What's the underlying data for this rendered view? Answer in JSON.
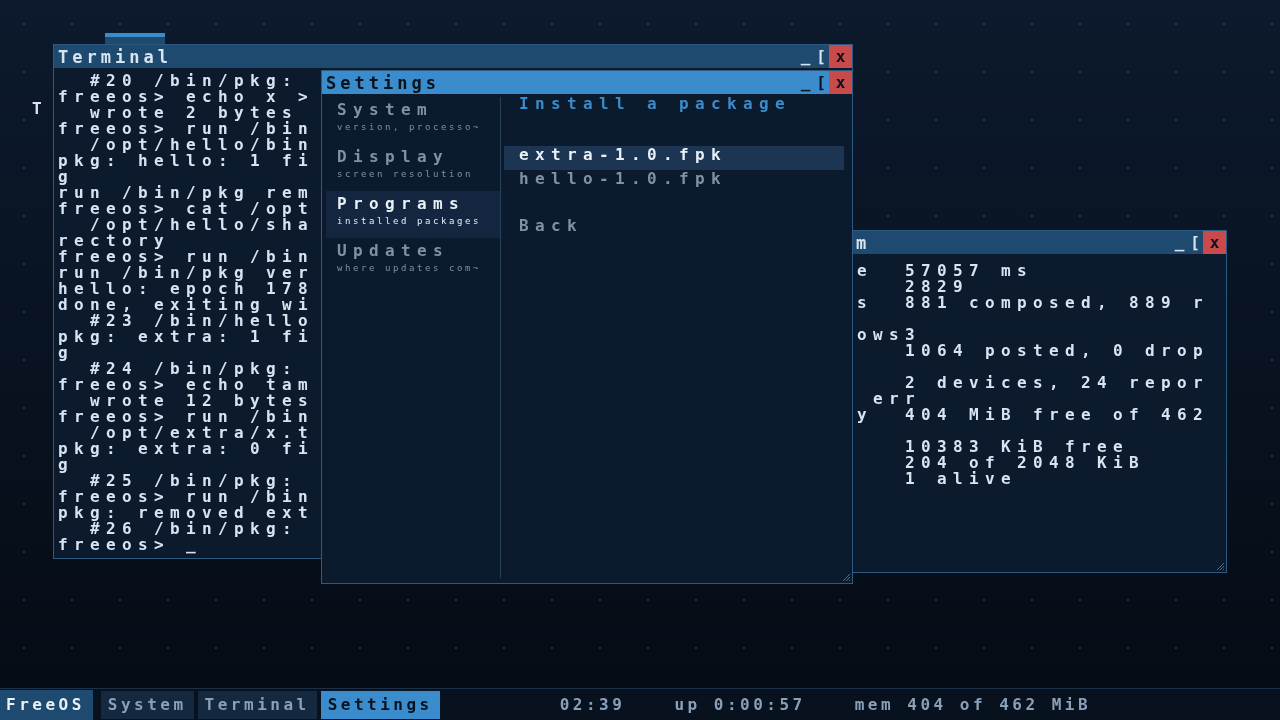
{
  "desktop": {
    "fragment": "T"
  },
  "terminal": {
    "title": "Terminal",
    "controls": {
      "minimize": "_",
      "maximize": "[",
      "close": "x"
    },
    "lines": [
      "  #20 /bin/pkg:",
      "freeos> echo x >",
      "  wrote 2 bytes",
      "freeos> run /bin",
      "  /opt/hello/bin",
      "pkg: hello: 1 fi",
      "g",
      "run /bin/pkg rem",
      "freeos> cat /opt",
      "  /opt/hello/sha",
      "rectory",
      "freeos> run /bin",
      "run /bin/pkg ver",
      "hello: epoch 178",
      "done, exiting wi",
      "  #23 /bin/hello",
      "pkg: extra: 1 fi",
      "g",
      "  #24 /bin/pkg:",
      "freeos> echo tam",
      "  wrote 12 bytes",
      "freeos> run /bin",
      "  /opt/extra/x.t",
      "pkg: extra: 0 fi",
      "g",
      "  #25 /bin/pkg:",
      "freeos> run /bin",
      "pkg: removed ext",
      "  #26 /bin/pkg:"
    ],
    "prompt": "freeos> ",
    "cursor": "_"
  },
  "settings": {
    "title": "Settings",
    "controls": {
      "minimize": "_",
      "maximize": "[",
      "close": "x"
    },
    "sidebar": [
      {
        "label": "System",
        "subtitle": "version, processo~",
        "selected": false
      },
      {
        "label": "Display",
        "subtitle": "screen resolution",
        "selected": false
      },
      {
        "label": "Programs",
        "subtitle": "installed packages",
        "selected": true
      },
      {
        "label": "Updates",
        "subtitle": "where updates com~",
        "selected": false
      }
    ],
    "heading": "Install a package",
    "packages": [
      {
        "name": "extra-1.0.fpk",
        "selected": true
      },
      {
        "name": "hello-1.0.fpk",
        "selected": false
      }
    ],
    "back": "Back"
  },
  "system": {
    "title": "m",
    "controls": {
      "minimize": "_",
      "maximize": "[",
      "close": "x"
    },
    "rows": [
      {
        "kind": "pair",
        "label": "e",
        "value": "57057 ms"
      },
      {
        "kind": "pair",
        "label": "",
        "value": "2829"
      },
      {
        "kind": "pair",
        "label": "s",
        "value": "881 composed, 889 r"
      },
      {
        "kind": "blank"
      },
      {
        "kind": "pair",
        "label": "ows",
        "value": "3"
      },
      {
        "kind": "pair",
        "label": "",
        "value": "1064 posted, 0 drop"
      },
      {
        "kind": "blank"
      },
      {
        "kind": "pair",
        "label": "",
        "value": "2 devices, 24 repor"
      },
      {
        "kind": "wrap",
        "value": "err"
      },
      {
        "kind": "pair",
        "label": "y",
        "value": "404 MiB free of 462"
      },
      {
        "kind": "blank"
      },
      {
        "kind": "pair",
        "label": "",
        "value": "10383 KiB free"
      },
      {
        "kind": "pair",
        "label": "",
        "value": "204 of 2048 KiB"
      },
      {
        "kind": "pair",
        "label": "",
        "value": "1 alive"
      }
    ]
  },
  "taskbar": {
    "start": "FreeOS",
    "apps": [
      {
        "label": "System",
        "selected": false
      },
      {
        "label": "Terminal",
        "selected": false
      },
      {
        "label": "Settings",
        "selected": true
      }
    ],
    "clock": "02:39",
    "uptime": "up 0:00:57",
    "memory": "mem 404 of 462 MiB"
  }
}
